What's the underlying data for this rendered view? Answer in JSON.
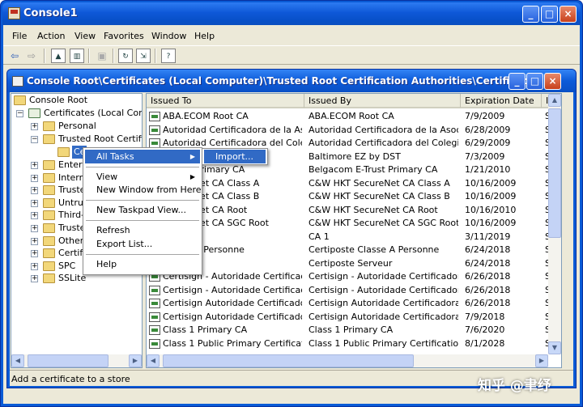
{
  "window": {
    "title": "Console1",
    "min": "_",
    "max": "□",
    "close": "×"
  },
  "menu": [
    "File",
    "Action",
    "View",
    "Favorites",
    "Window",
    "Help"
  ],
  "toolbar": {
    "back": "⇦",
    "fwd": "⇨"
  },
  "inner_window": {
    "title": "Console Root\\Certificates (Local Computer)\\Trusted Root Certification Authorities\\Certificates"
  },
  "tree": {
    "root": "Console Root",
    "certs": "Certificates (Local Comput",
    "personal": "Personal",
    "trusted_root": "Trusted Root Certifica",
    "cert_node": "Ce",
    "items": [
      "Enterp",
      "Interm",
      "Truste",
      "Untrus",
      "Third-",
      "Truste",
      "Other",
      "Certifi",
      "SPC",
      "SSLite"
    ]
  },
  "columns": {
    "issued_to": "Issued To",
    "issued_by": "Issued By",
    "expiration": "Expiration Date",
    "extra": "I"
  },
  "rows": [
    {
      "to": "ABA.ECOM Root CA",
      "by": "ABA.ECOM Root CA",
      "exp": "7/9/2009",
      "i": "S"
    },
    {
      "to": "Autoridad Certificadora de la Asoci...",
      "by": "Autoridad Certificadora de la Asocia...",
      "exp": "6/28/2009",
      "i": "S"
    },
    {
      "to": "Autoridad Certificadora del Colegi...",
      "by": "Autoridad Certificadora del Colegio ...",
      "exp": "6/29/2009",
      "i": "S"
    },
    {
      "to": "",
      "by": "Baltimore EZ by DST",
      "exp": "7/3/2009",
      "i": "S"
    },
    {
      "to": "E-Trust Primary CA",
      "by": "Belgacom E-Trust Primary CA",
      "exp": "1/21/2010",
      "i": "S"
    },
    {
      "to": "SecureNet CA Class A",
      "by": "C&W HKT SecureNet CA Class A",
      "exp": "10/16/2009",
      "i": "S"
    },
    {
      "to": "SecureNet CA Class B",
      "by": "C&W HKT SecureNet CA Class B",
      "exp": "10/16/2009",
      "i": "S"
    },
    {
      "to": "SecureNet CA Root",
      "by": "C&W HKT SecureNet CA Root",
      "exp": "10/16/2010",
      "i": "S"
    },
    {
      "to": "SecureNet CA SGC Root",
      "by": "C&W HKT SecureNet CA SGC Root",
      "exp": "10/16/2009",
      "i": "S"
    },
    {
      "to": "",
      "by": "CA 1",
      "exp": "3/11/2019",
      "i": "S"
    },
    {
      "to": "Classe A Personne",
      "by": "Certiposte Classe A Personne",
      "exp": "6/24/2018",
      "i": "S"
    },
    {
      "to": "Serveur",
      "by": "Certiposte Serveur",
      "exp": "6/24/2018",
      "i": "S"
    },
    {
      "to": "Certisign - Autoridade Certificador...",
      "by": "Certisign - Autoridade Certificadora ...",
      "exp": "6/26/2018",
      "i": "S"
    },
    {
      "to": "Certisign - Autoridade Certificador...",
      "by": "Certisign - Autoridade Certificadora ...",
      "exp": "6/26/2018",
      "i": "S"
    },
    {
      "to": "Certisign Autoridade Certificadora ...",
      "by": "Certisign Autoridade Certificadora A...",
      "exp": "6/26/2018",
      "i": "S"
    },
    {
      "to": "Certisign Autoridade Certificadora ...",
      "by": "Certisign Autoridade Certificadora A...",
      "exp": "7/9/2018",
      "i": "S"
    },
    {
      "to": "Class 1 Primary CA",
      "by": "Class 1 Primary CA",
      "exp": "7/6/2020",
      "i": "S"
    },
    {
      "to": "Class 1 Public Primary Certification...",
      "by": "Class 1 Public Primary Certification A...",
      "exp": "8/1/2028",
      "i": "S"
    }
  ],
  "context_menu": {
    "all_tasks": "All Tasks",
    "view": "View",
    "new_window": "New Window from Here",
    "new_taskpad": "New Taskpad View...",
    "refresh": "Refresh",
    "export": "Export List...",
    "help": "Help"
  },
  "submenu": {
    "import": "Import..."
  },
  "status": "Add a certificate to a store",
  "watermark": "知乎 @聿纾"
}
